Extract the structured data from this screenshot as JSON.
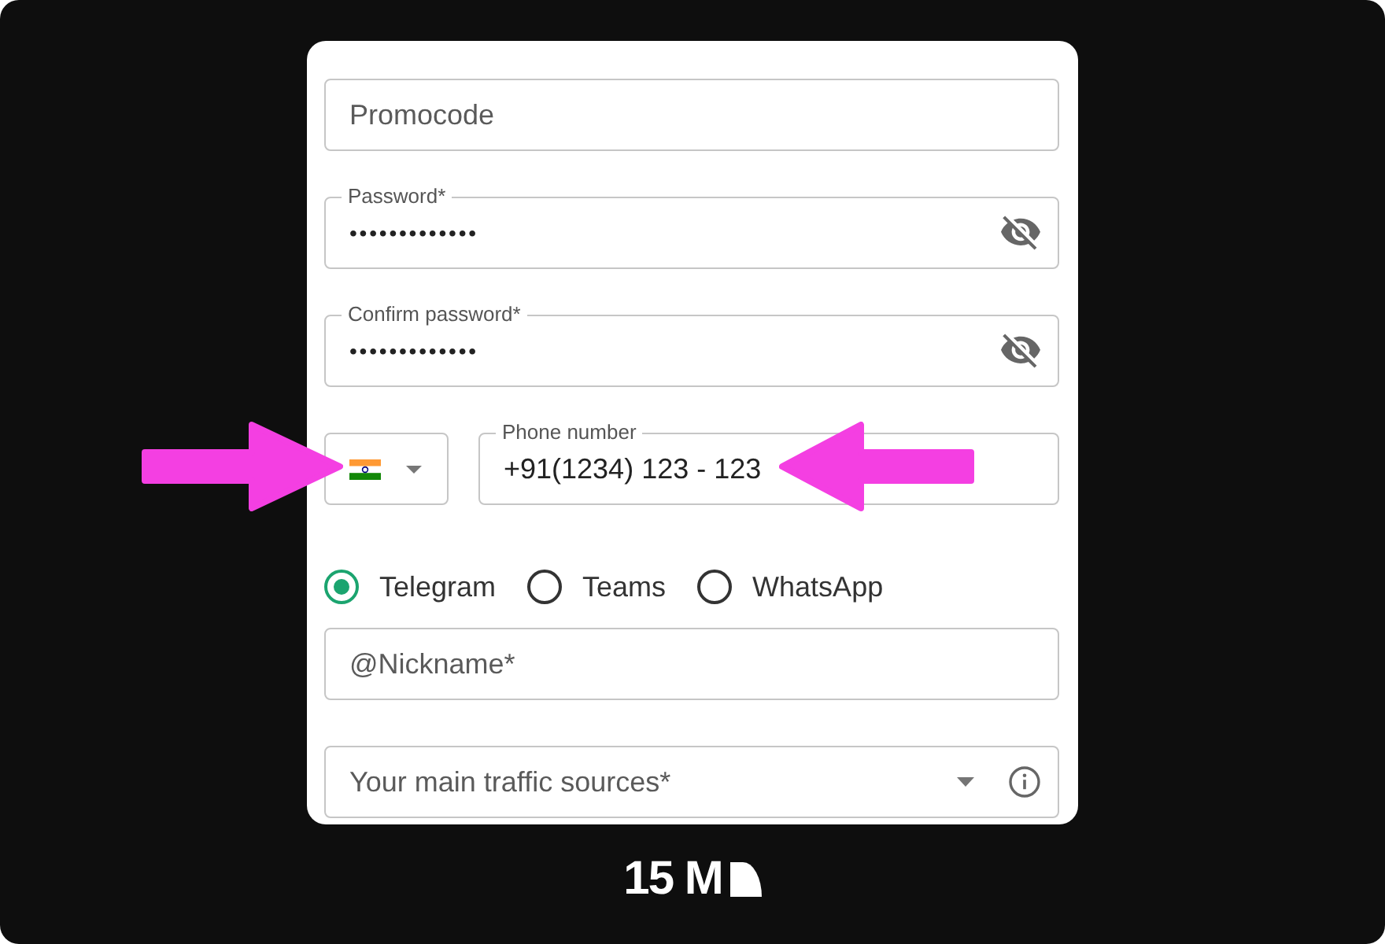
{
  "form": {
    "fields": [
      {
        "kind": "text",
        "placeholder": "Promocode"
      },
      {
        "kind": "password",
        "label": "Password*",
        "value": "•••••••••••••",
        "revealed": false
      },
      {
        "kind": "password",
        "label": "Confirm password*",
        "value": "•••••••••••••",
        "revealed": false
      },
      {
        "kind": "phone",
        "label": "Phone number",
        "value": "+91(1234) 123 - 123"
      },
      {
        "kind": "radio_group",
        "options": [
          {
            "label": "Telegram",
            "selected": true
          },
          {
            "label": "Teams",
            "selected": false
          },
          {
            "label": "WhatsApp",
            "selected": false
          }
        ]
      },
      {
        "kind": "text",
        "placeholder": "@Nickname*"
      },
      {
        "kind": "select",
        "placeholder": "Your main traffic sources*"
      }
    ]
  },
  "annotations": [
    {
      "kind": "right_arrow"
    },
    {
      "kind": "left_arrow"
    }
  ],
  "footer": {
    "logo_text": "15 M"
  }
}
